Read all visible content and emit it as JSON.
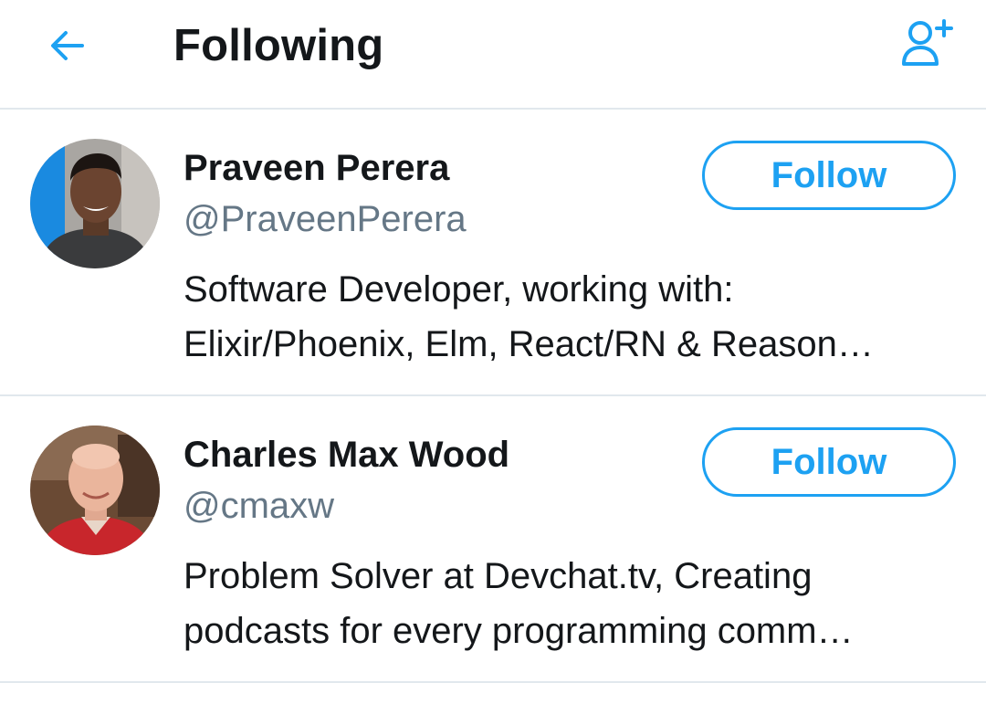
{
  "header": {
    "title": "Following",
    "back_icon": "arrow-left-icon",
    "add_user_icon": "add-user-icon"
  },
  "colors": {
    "accent": "#1da1f2",
    "text_primary": "#14171a",
    "text_secondary": "#657786",
    "divider": "#e1e8ed"
  },
  "users": [
    {
      "name": "Praveen Perera",
      "handle": "@PraveenPerera",
      "bio_lines": [
        "Software Developer, working with:",
        "Elixir/Phoenix, Elm, React/RN & Reason…"
      ],
      "follow_label": "Follow"
    },
    {
      "name": "Charles Max Wood",
      "handle": "@cmaxw",
      "bio_lines": [
        "Problem Solver at Devchat.tv, Creating",
        "podcasts for every programming comm…"
      ],
      "follow_label": "Follow"
    }
  ]
}
